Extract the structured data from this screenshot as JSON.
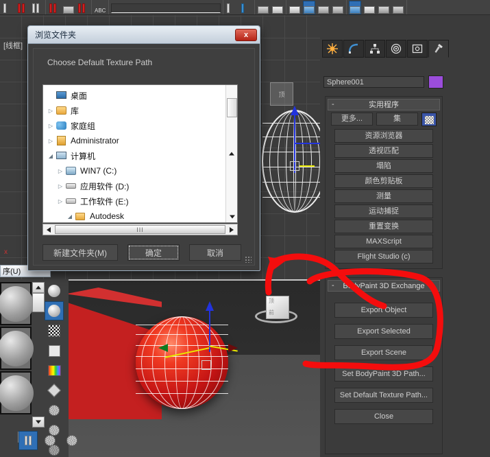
{
  "app": {
    "viewport_top_label": "[线框]",
    "axis_label": "x"
  },
  "toolbar": {
    "text_icon_label": "ABC"
  },
  "material_editor": {
    "title": "序(U)",
    "slot_count": 3
  },
  "dialog": {
    "title": "浏览文件夹",
    "close_label": "x",
    "prompt": "Choose Default Texture Path",
    "tree": [
      {
        "label": "桌面",
        "icon": "desktop-icon",
        "indent": 0,
        "expander": "",
        "expanded": false
      },
      {
        "label": "库",
        "icon": "library-icon",
        "indent": 0,
        "expander": "▷",
        "expanded": false
      },
      {
        "label": "家庭组",
        "icon": "homegroup-icon",
        "indent": 0,
        "expander": "▷",
        "expanded": false
      },
      {
        "label": "Administrator",
        "icon": "user-folder-icon",
        "indent": 0,
        "expander": "▷",
        "expanded": false
      },
      {
        "label": "计算机",
        "icon": "computer-icon",
        "indent": 0,
        "expander": "◢",
        "expanded": true
      },
      {
        "label": "WIN7 (C:)",
        "icon": "system-drive-icon",
        "indent": 1,
        "expander": "▷",
        "expanded": false
      },
      {
        "label": "应用软件 (D:)",
        "icon": "drive-icon",
        "indent": 1,
        "expander": "▷",
        "expanded": false
      },
      {
        "label": "工作软件 (E:)",
        "icon": "drive-icon",
        "indent": 1,
        "expander": "▷",
        "expanded": false
      },
      {
        "label": "Autodesk",
        "icon": "folder-icon",
        "indent": 2,
        "expander": "◢",
        "expanded": true
      }
    ],
    "hscroll_grip": "III",
    "buttons": {
      "new_folder": "新建文件夹(M)",
      "ok": "确定",
      "cancel": "取消"
    }
  },
  "command_panel": {
    "tabs": [
      {
        "name": "create-tab",
        "icon": "star-icon"
      },
      {
        "name": "modify-tab",
        "icon": "curve-icon"
      },
      {
        "name": "hierarchy-tab",
        "icon": "hierarchy-icon"
      },
      {
        "name": "motion-tab",
        "icon": "motion-icon"
      },
      {
        "name": "display-tab",
        "icon": "display-icon"
      },
      {
        "name": "utilities-tab",
        "icon": "hammer-icon"
      }
    ],
    "active_tab_index": 5,
    "object_name": "Sphere001",
    "object_color": "#9b4ddb",
    "utilities": {
      "rollout_title": "实用程序",
      "minus": "-",
      "more_label": "更多...",
      "sets_label": "集",
      "buttons": [
        "资源浏览器",
        "透视匹配",
        "塌陷",
        "颜色剪贴板",
        "测量",
        "运动捕捉",
        "重置变换",
        "MAXScript",
        "Flight Studio (c)"
      ]
    },
    "bodypaint": {
      "rollout_title": "BodyPaint 3D Exchange",
      "buttons": [
        "Export Object",
        "Export Selected",
        "Export Scene",
        "Set BodyPaint 3D Path...",
        "Set Default Texture Path...",
        "Close"
      ]
    }
  },
  "annotations": {
    "color": "#f40d0d",
    "arrow_note": "arrow pointing from viewcube toward export buttons",
    "ellipse_note": "red ellipse circling the three export buttons"
  },
  "viewcube": {
    "top_label": "顶",
    "front_label": "前"
  }
}
